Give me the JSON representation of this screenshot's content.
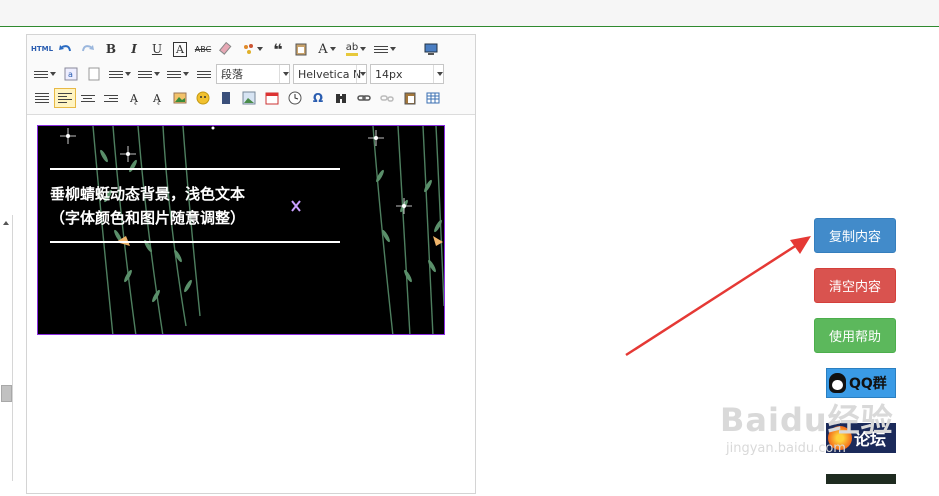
{
  "toolbar": {
    "row1": [
      "HTML",
      "undo-icon",
      "redo-icon",
      "B",
      "I",
      "U",
      "A",
      "ABC",
      "eraser-icon",
      "format-brush-icon",
      "quote-icon",
      "paste-icon",
      "A",
      "ab",
      "list-ordered-icon",
      "preview-icon"
    ],
    "paragraph_select": "段落",
    "font_select": "Helvetica N",
    "size_select": "14px"
  },
  "banner": {
    "line1": "垂柳蜻蜓动态背景，浅色文本",
    "line2": "（字体颜色和图片随意调整）"
  },
  "buttons": {
    "copy": "复制内容",
    "clear": "清空内容",
    "help": "使用帮助"
  },
  "badges": {
    "qq": "QQ群",
    "forum": "论坛"
  },
  "watermark": {
    "brand": "Baidu经验",
    "url": "jingyan.baidu.com"
  },
  "colors": {
    "copy": "#428bca",
    "clear": "#d9534f",
    "help": "#5cb85c",
    "arrow": "#e53935"
  }
}
